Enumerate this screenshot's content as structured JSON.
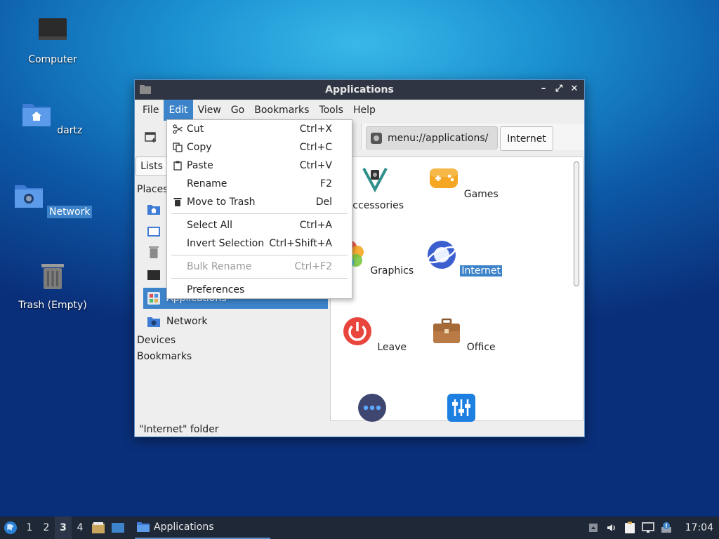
{
  "desktop": {
    "icons": [
      {
        "label": "Computer"
      },
      {
        "label": "dartz"
      },
      {
        "label": "Network"
      },
      {
        "label": "Trash (Empty)"
      }
    ]
  },
  "window": {
    "title": "Applications",
    "controls": {
      "minimize": "–",
      "maximize": "⤢",
      "close": "✕"
    },
    "menu": [
      "File",
      "Edit",
      "View",
      "Go",
      "Bookmarks",
      "Tools",
      "Help"
    ],
    "active_menu": "Edit",
    "location": "menu://applications/",
    "breadcrumb": "Internet",
    "side_pane_mode": "Lists",
    "sidebar": {
      "places_header": "Places",
      "items": [
        {
          "label": "",
          "icon": "home-folder-icon"
        },
        {
          "label": "",
          "icon": "desktop-icon"
        },
        {
          "label": "",
          "icon": "trash-icon"
        },
        {
          "label": "",
          "icon": "computer-icon"
        },
        {
          "label": "Applications",
          "icon": "applications-icon"
        },
        {
          "label": "Network",
          "icon": "network-folder-icon"
        }
      ],
      "devices_header": "Devices",
      "bookmarks_header": "Bookmarks"
    },
    "apps": [
      {
        "label": "Accessories",
        "icon": "accessories-icon"
      },
      {
        "label": "Games",
        "icon": "games-icon"
      },
      {
        "label": "Graphics",
        "icon": "graphics-icon"
      },
      {
        "label": "Internet",
        "icon": "internet-icon"
      },
      {
        "label": "Leave",
        "icon": "leave-icon"
      },
      {
        "label": "Office",
        "icon": "office-icon"
      },
      {
        "label": "",
        "icon": "other-icon"
      },
      {
        "label": "",
        "icon": "preferences-icon"
      }
    ],
    "status": "\"Internet\" folder"
  },
  "edit_menu": {
    "items": [
      {
        "label": "Cut",
        "shortcut": "Ctrl+X",
        "icon": "scissors-icon"
      },
      {
        "label": "Copy",
        "shortcut": "Ctrl+C",
        "icon": "copy-icon"
      },
      {
        "label": "Paste",
        "shortcut": "Ctrl+V",
        "icon": "paste-icon"
      },
      {
        "label": "Rename",
        "shortcut": "F2"
      },
      {
        "label": "Move to Trash",
        "shortcut": "Del",
        "icon": "trash-icon"
      },
      {
        "label": "Select All",
        "shortcut": "Ctrl+A"
      },
      {
        "label": "Invert Selection",
        "shortcut": "Ctrl+Shift+A"
      },
      {
        "label": "Bulk Rename",
        "shortcut": "Ctrl+F2",
        "disabled": true
      },
      {
        "label": "Preferences",
        "shortcut": ""
      }
    ]
  },
  "taskbar": {
    "workspaces": [
      "1",
      "2",
      "3",
      "4"
    ],
    "active_workspace": "3",
    "task_label": "Applications",
    "clock": "17:04"
  },
  "colors": {
    "accent": "#3d83c9",
    "titlebar": "#2f3542",
    "taskbar": "#1f2837"
  }
}
